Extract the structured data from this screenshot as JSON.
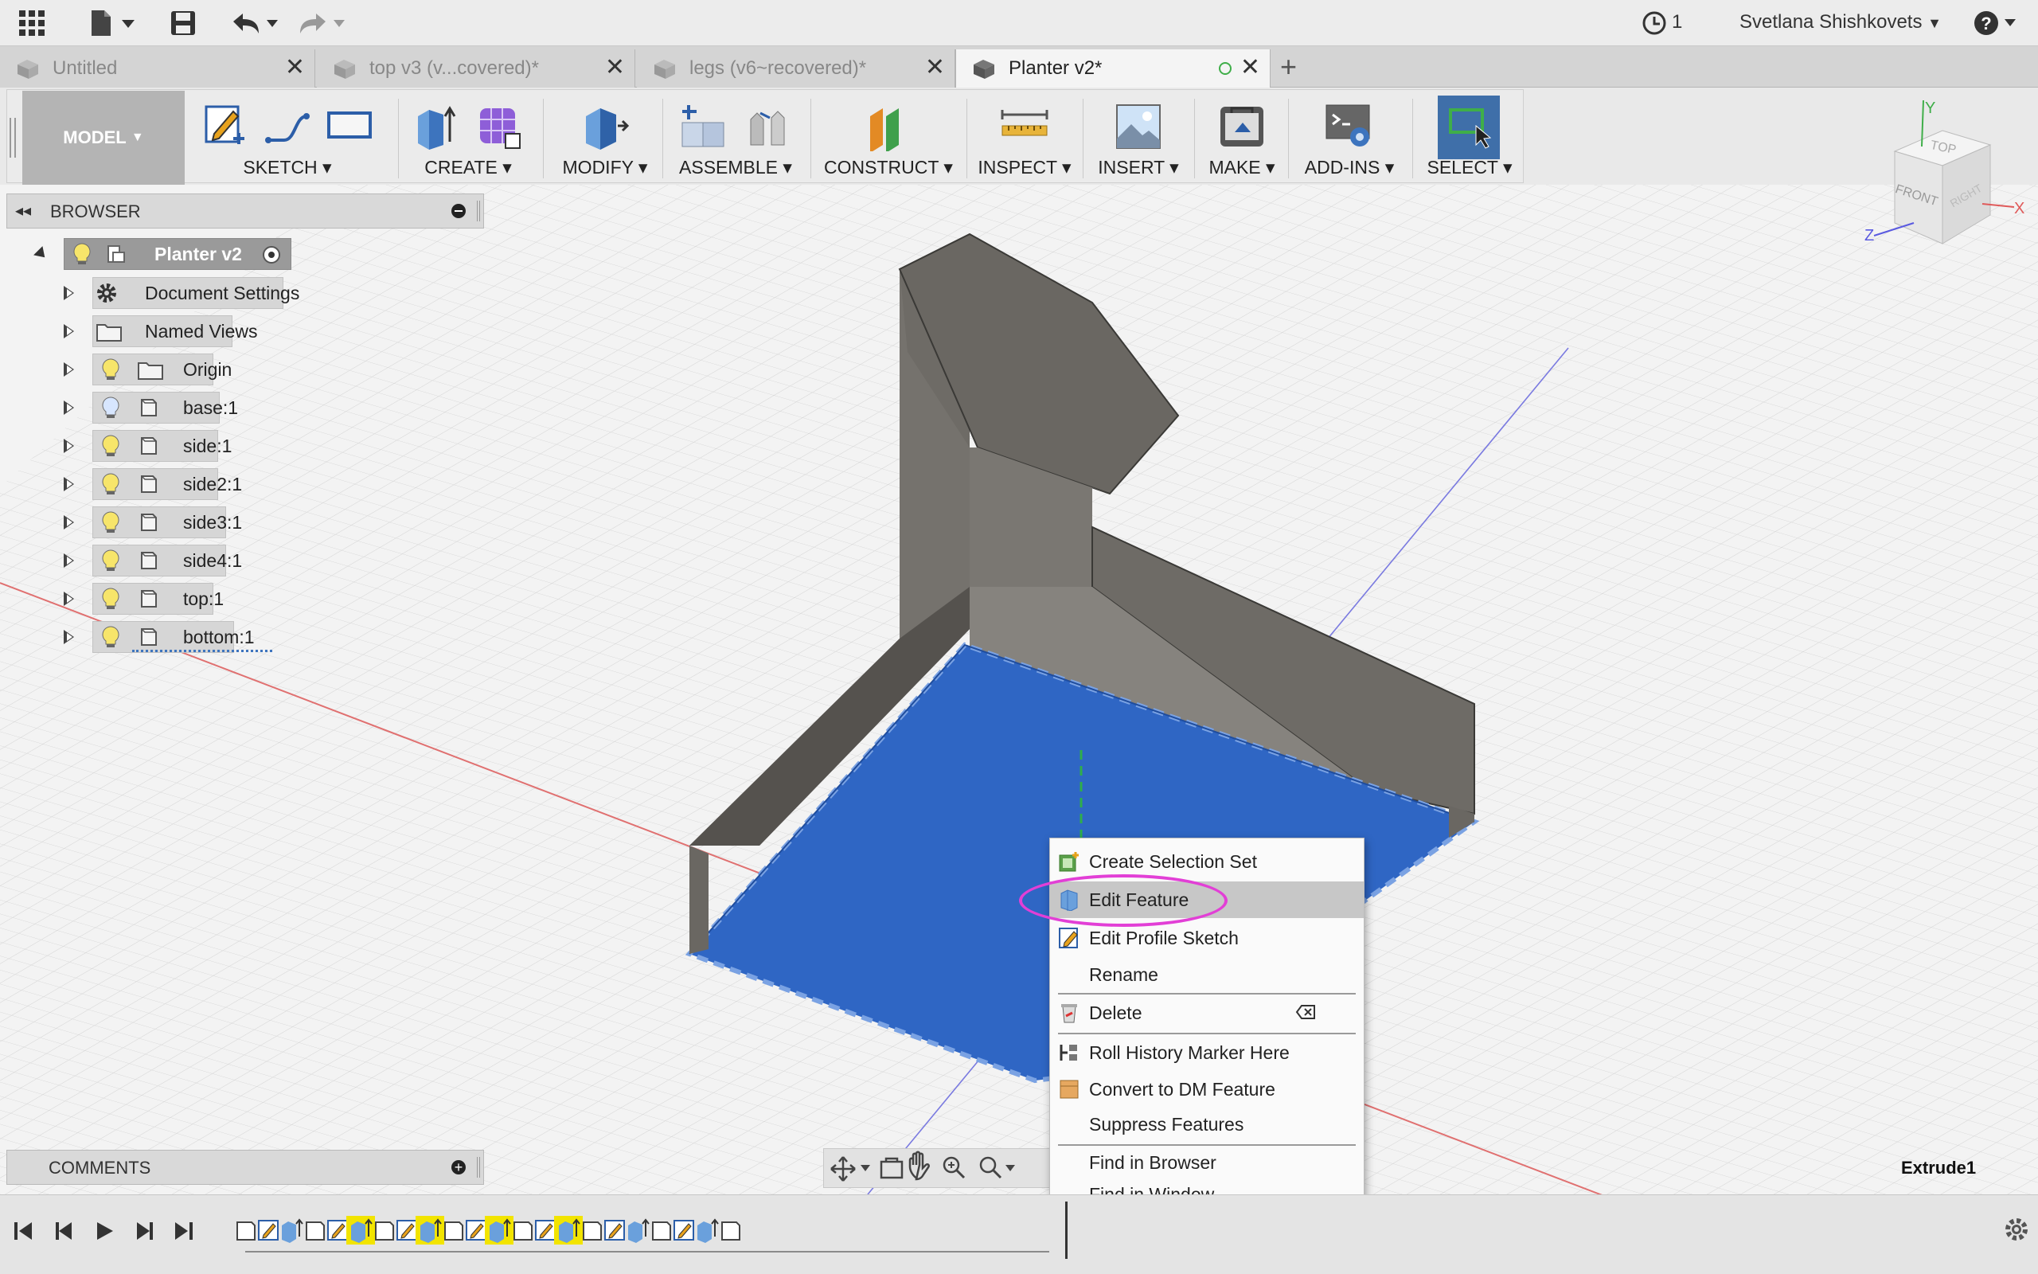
{
  "titlebar": {
    "jobs_count": "1",
    "user_name": "Svetlana Shishkovets",
    "icons": [
      "apps-grid-icon",
      "file-icon",
      "save-icon",
      "undo-icon",
      "redo-icon",
      "job-status-icon",
      "help-icon"
    ]
  },
  "tabs": [
    {
      "label": "Untitled",
      "active": false
    },
    {
      "label": "top v3 (v...covered)*",
      "active": false
    },
    {
      "label": "legs (v6~recovered)*",
      "active": false
    },
    {
      "label": "Planter v2*",
      "active": true
    }
  ],
  "toolbar": {
    "workspace": "MODEL",
    "groups": [
      {
        "label": "SKETCH"
      },
      {
        "label": "CREATE"
      },
      {
        "label": "MODIFY"
      },
      {
        "label": "ASSEMBLE"
      },
      {
        "label": "CONSTRUCT"
      },
      {
        "label": "INSPECT"
      },
      {
        "label": "INSERT"
      },
      {
        "label": "MAKE"
      },
      {
        "label": "ADD-INS"
      },
      {
        "label": "SELECT"
      }
    ]
  },
  "browser": {
    "title": "BROWSER",
    "root": "Planter v2",
    "items": [
      {
        "label": "Document Settings",
        "icon": "gear-icon"
      },
      {
        "label": "Named Views",
        "icon": "folder-icon"
      },
      {
        "label": "Origin",
        "icon": "folder-icon"
      },
      {
        "label": "base:1",
        "icon": "body-icon"
      },
      {
        "label": "side:1",
        "icon": "body-icon"
      },
      {
        "label": "side2:1",
        "icon": "body-icon"
      },
      {
        "label": "side3:1",
        "icon": "body-icon"
      },
      {
        "label": "side4:1",
        "icon": "body-icon"
      },
      {
        "label": "top:1",
        "icon": "body-icon"
      },
      {
        "label": "bottom:1",
        "icon": "body-icon"
      }
    ]
  },
  "comments": {
    "title": "COMMENTS"
  },
  "viewcube": {
    "top": "TOP",
    "front": "FRONT",
    "right": "RIGHT",
    "x": "X",
    "y": "Y",
    "z": "Z"
  },
  "context_menu": {
    "items": [
      {
        "label": "Create Selection Set",
        "icon": "selection-set-icon"
      },
      {
        "label": "Edit Feature",
        "icon": "edit-feature-icon",
        "highlighted": true
      },
      {
        "label": "Edit Profile Sketch",
        "icon": "edit-sketch-icon"
      },
      {
        "label": "Rename",
        "icon": ""
      },
      {
        "label": "Delete",
        "icon": "delete-icon",
        "shortcut_icon": "delete-key-icon"
      },
      {
        "label": "Roll History Marker Here",
        "icon": "history-marker-icon"
      },
      {
        "label": "Convert to DM Feature",
        "icon": "convert-icon"
      },
      {
        "label": "Suppress Features",
        "icon": ""
      },
      {
        "label": "Find in Browser",
        "icon": ""
      },
      {
        "label": "Find in Window",
        "icon": ""
      }
    ]
  },
  "status": {
    "selected_feature": "Extrude1"
  },
  "colors": {
    "selection_blue": "#2f66c4",
    "highlight_ring": "#e23fd6",
    "timeline_highlight": "#f2e400",
    "body_gray": "#6e6b66"
  }
}
